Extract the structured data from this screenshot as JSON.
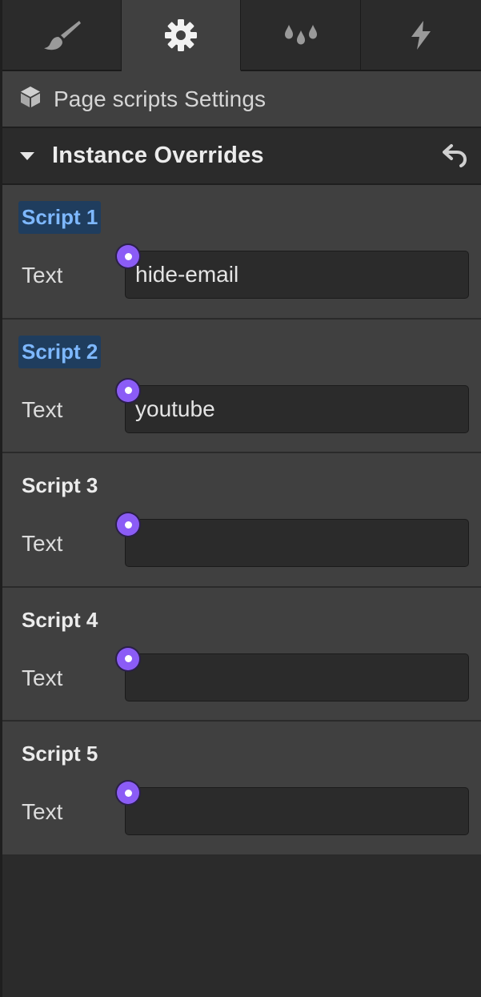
{
  "tabs": [
    {
      "icon": "paintbrush-icon",
      "active": false
    },
    {
      "icon": "gear-icon",
      "active": true
    },
    {
      "icon": "drops-icon",
      "active": false
    },
    {
      "icon": "lightning-icon",
      "active": false
    }
  ],
  "panel": {
    "icon": "cube-icon",
    "title": "Page scripts Settings"
  },
  "section": {
    "title": "Instance Overrides",
    "expanded": true,
    "reset_icon": "undo-icon"
  },
  "scripts": [
    {
      "label": "Script 1",
      "highlighted": true,
      "field_label": "Text",
      "value": ""
    },
    {
      "label": "Script 2",
      "highlighted": true,
      "field_label": "Text",
      "value": "youtube"
    },
    {
      "label": "Script 3",
      "highlighted": false,
      "field_label": "Text",
      "value": ""
    },
    {
      "label": "Script 4",
      "highlighted": false,
      "field_label": "Text",
      "value": ""
    },
    {
      "label": "Script 5",
      "highlighted": false,
      "field_label": "Text",
      "value": ""
    }
  ],
  "script1_value": "hide-email",
  "colors": {
    "accent_purple": "#8b5cf6",
    "highlight_bg": "#1f3d5e",
    "highlight_text": "#7eb8ff",
    "panel_bg": "#404040",
    "dark_bg": "#2b2b2b"
  }
}
